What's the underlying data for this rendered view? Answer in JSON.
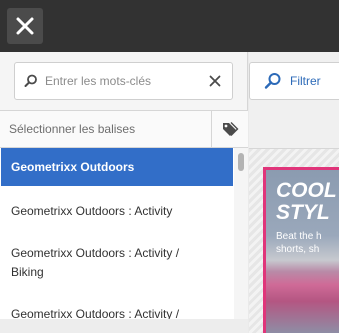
{
  "topbar": {
    "close_icon": "close-icon",
    "color": "#323232"
  },
  "search": {
    "placeholder": "Entrer les mots-clés",
    "value": "",
    "search_icon": "search-icon",
    "clear_icon": "close-icon"
  },
  "tags": {
    "select_label": "Sélectionner les balises",
    "tag_icon": "tag-icon"
  },
  "list": {
    "items": [
      {
        "label": "Geometrixx Outdoors",
        "selected": true
      },
      {
        "label": "Geometrixx Outdoors : Activity",
        "selected": false
      },
      {
        "label": "Geometrixx Outdoors : Activity / Biking",
        "selected": false
      },
      {
        "label": "Geometrixx Outdoors : Activity /",
        "selected": false
      }
    ],
    "selected_color": "#326ec8"
  },
  "filter": {
    "label": "Filtrer",
    "icon": "search-icon",
    "color": "#2c6ab8"
  },
  "card": {
    "headline": "COOL STYL",
    "subtext": "Beat the h\nshorts, sh",
    "accent": "#e0357a"
  }
}
